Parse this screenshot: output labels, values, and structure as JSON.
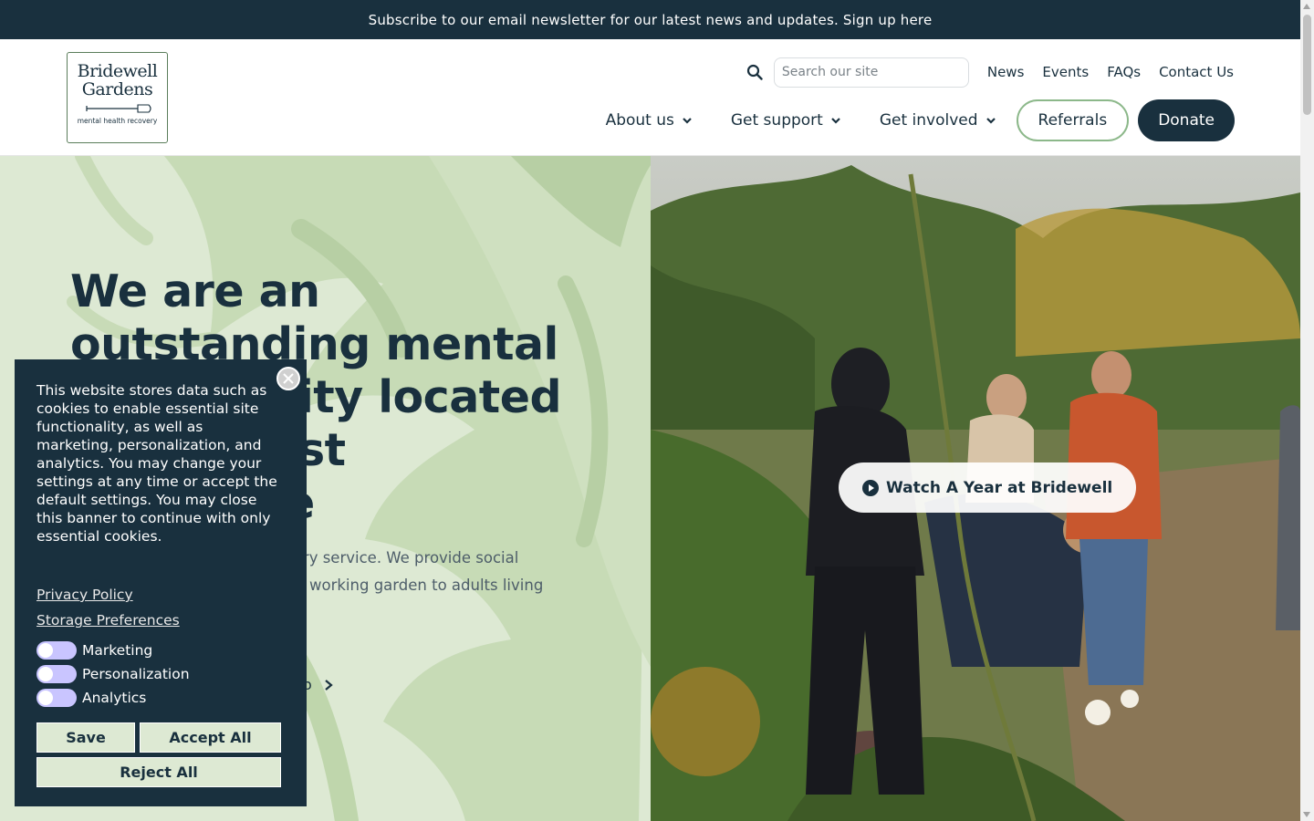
{
  "announcement": {
    "text": "Subscribe to our email newsletter for our latest news and updates. Sign up here"
  },
  "logo": {
    "line1": "Bridewell",
    "line2": "Gardens",
    "tagline": "mental health recovery"
  },
  "utility_nav": {
    "search_placeholder": "Search our site",
    "links": [
      "News",
      "Events",
      "FAQs",
      "Contact Us"
    ]
  },
  "main_nav": {
    "dropdowns": [
      "About us",
      "Get support",
      "Get involved"
    ],
    "referrals": "Referrals",
    "donate": "Donate"
  },
  "hero": {
    "title_line1": "We are an",
    "title_line2": "outstanding mental",
    "title_line3": "ity located",
    "title_line4": "st",
    "title_line5": "e",
    "body_line1": "very service. We provide social",
    "body_line2": "working garden to adults living",
    "link_fragment": "o",
    "watch_button": "Watch A Year at Bridewell"
  },
  "cookie_banner": {
    "text": "This website stores data such as cookies to enable essential site functionality, as well as marketing, personalization, and analytics. You may change your settings at any time or accept the default settings. You may close this banner to continue with only essential cookies.",
    "privacy_link": "Privacy Policy",
    "storage_link": "Storage Preferences",
    "toggles": [
      {
        "label": "Marketing",
        "on": false
      },
      {
        "label": "Personalization",
        "on": false
      },
      {
        "label": "Analytics",
        "on": false
      }
    ],
    "save": "Save",
    "accept_all": "Accept All",
    "reject_all": "Reject All"
  },
  "colors": {
    "navy": "#19303e",
    "sage": "#dde9d3",
    "sage_dark": "#b7cfa4",
    "referrals_border": "#8cb88a",
    "toggle_off": "#c9c5ff"
  }
}
